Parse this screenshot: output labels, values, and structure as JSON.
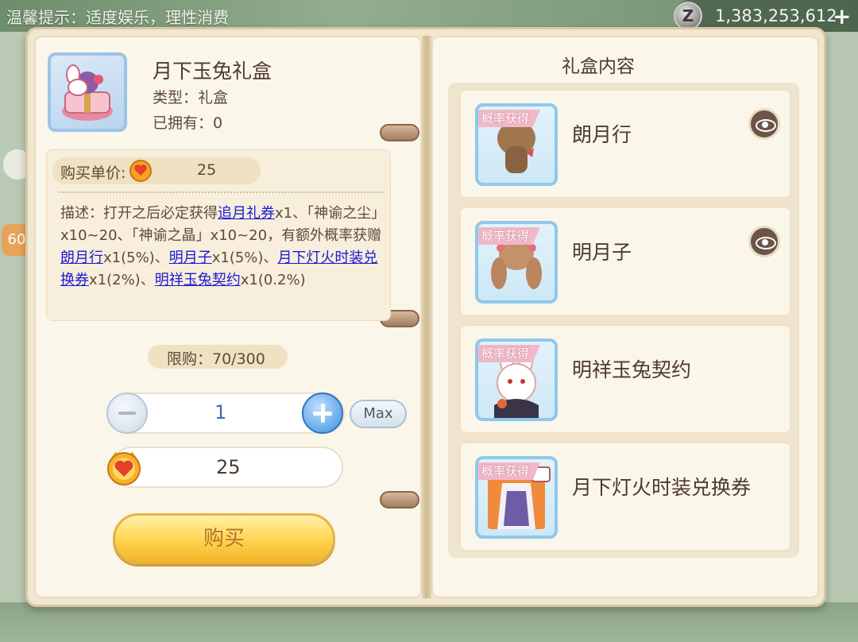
{
  "top_bar": {
    "tip": "温馨提示：适度娱乐，理性消费",
    "currency_value": "1,383,253,612",
    "currency_icon": "z-coin-icon",
    "add_icon": "plus-icon"
  },
  "item": {
    "title": "月下玉兔礼盒",
    "type_label": "类型：礼盒",
    "owned_label": "已拥有：0",
    "price_label": "购买单价:",
    "price_value": "25",
    "price_icon": "heart-coin-icon",
    "description": {
      "prefix": "描述：打开之后必定获得",
      "link1": "追月礼券",
      "mid1": "x1、「神谕之尘」x10~20、「神谕之晶」x10~20，有额外概率获赠",
      "link2": "朗月行",
      "mid2": "x1(5%)、",
      "link3": "明月子",
      "mid3": "x1(5%)、",
      "link4": "月下灯火时装兑换券",
      "mid4": "x1(2%)、",
      "link5": "明祥玉兔契约",
      "suffix": "x1(0.2%)"
    }
  },
  "purchase": {
    "limit": "限购：70/300",
    "quantity": "1",
    "max_label": "Max",
    "total": "25",
    "buy_label": "购买"
  },
  "gift_contents": {
    "title": "礼盒内容",
    "tag": "概率获得",
    "items": [
      {
        "name": "朗月行",
        "has_preview": true
      },
      {
        "name": "明月子",
        "has_preview": true
      },
      {
        "name": "明祥玉兔契约",
        "has_preview": false
      },
      {
        "name": "月下灯火时装兑换券",
        "has_preview": false
      }
    ]
  },
  "side": {
    "badge": "60"
  },
  "colors": {
    "link": "#1b1bd6",
    "accent_gold": "#ffd34d",
    "tag_pink": "#f0b8c8",
    "thumb_border": "#8fc8ec"
  }
}
